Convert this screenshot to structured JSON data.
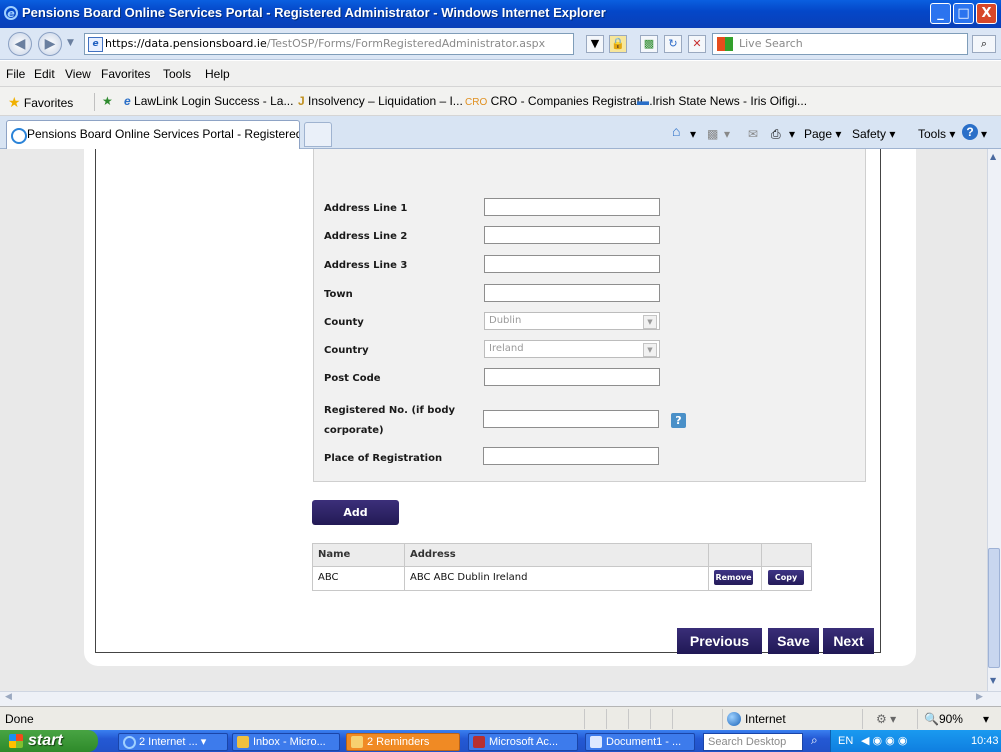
{
  "window": {
    "title": "Pensions Board Online Services Portal - Registered Administrator - Windows Internet Explorer",
    "min": "_",
    "max": "□",
    "close": "X"
  },
  "addressbar": {
    "url_prefix": "https://data.",
    "url_domain": "pensionsboard.ie",
    "url_path": "/TestOSP/Forms/FormRegisteredAdministrator.aspx",
    "search_placeholder": "Live Search"
  },
  "menubar": [
    "File",
    "Edit",
    "View",
    "Favorites",
    "Tools",
    "Help"
  ],
  "favorites": {
    "label": "Favorites",
    "items": [
      "LawLink Login Success - La...",
      "Insolvency – Liquidation – I...",
      "CRO - Companies Registrati...",
      "Irish State News - Iris Oifigi..."
    ]
  },
  "tab": {
    "label": "Pensions Board Online Services Portal - Registered Ad..."
  },
  "commandbar": {
    "page": "Page",
    "safety": "Safety",
    "tools": "Tools"
  },
  "form": {
    "address1": "Address Line 1",
    "address2": "Address Line 2",
    "address3": "Address Line 3",
    "town": "Town",
    "county": "County",
    "county_value": "Dublin",
    "country": "Country",
    "country_value": "Ireland",
    "postcode": "Post Code",
    "regno_line1": "Registered No. (if body",
    "regno_line2": "corporate)",
    "place": "Place of Registration",
    "help": "?",
    "add": "Add"
  },
  "grid": {
    "col_name": "Name",
    "col_address": "Address",
    "rows": [
      {
        "name": "ABC",
        "address": "ABC ABC Dublin Ireland",
        "remove": "Remove",
        "copy": "Copy"
      }
    ]
  },
  "nav": {
    "previous": "Previous",
    "save": "Save",
    "next": "Next"
  },
  "statusbar": {
    "status": "Done",
    "zone": "Internet",
    "zoom": "90%"
  },
  "taskbar": {
    "start": "start",
    "tasks": [
      "2 Internet ...",
      "Inbox - Micro...",
      "2 Reminders",
      "Microsoft Ac...",
      "Document1 - ..."
    ],
    "search_placeholder": "Search Desktop",
    "lang": "EN",
    "clock": "10:43"
  }
}
